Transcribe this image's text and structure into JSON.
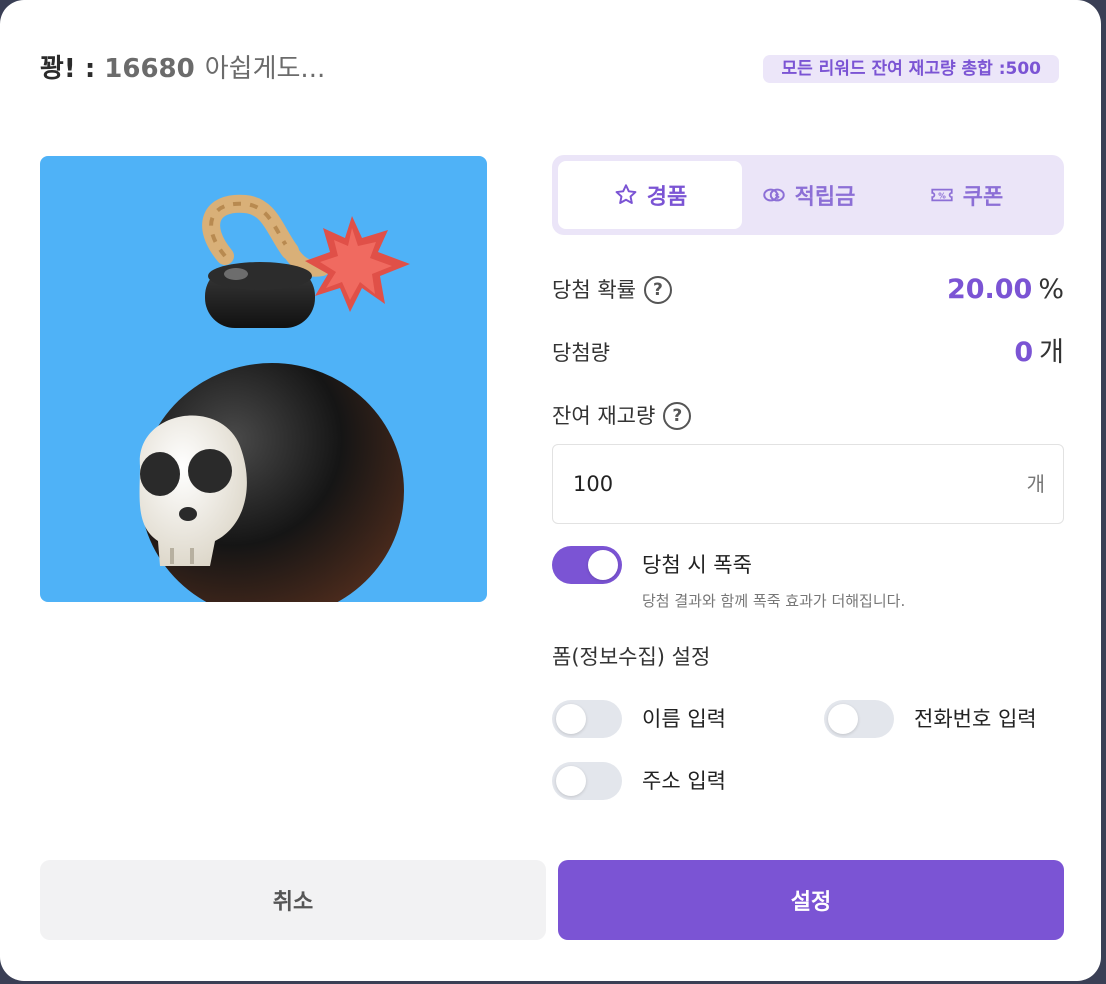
{
  "header": {
    "title_prefix": "꽝! : ",
    "score": "16680",
    "title_suffix": "아쉽게도...",
    "total_stock_badge": "모든 리워드 잔여 재고량 총합 :500"
  },
  "image": {
    "icon": "skull-bomb-image",
    "background": "#4fb2f7"
  },
  "tabs": [
    {
      "label": "경품",
      "icon": "star-icon",
      "active": true
    },
    {
      "label": "적립금",
      "icon": "coin-icon",
      "active": false
    },
    {
      "label": "쿠폰",
      "icon": "coupon-icon",
      "active": false
    }
  ],
  "win_probability": {
    "label": "당첨 확률",
    "value": "20.00",
    "unit": "%"
  },
  "win_count": {
    "label": "당첨량",
    "value": "0",
    "unit": "개"
  },
  "stock": {
    "label": "잔여 재고량",
    "value": "100",
    "unit": "개"
  },
  "fireworks": {
    "label": "당첨 시 폭죽",
    "description": "당첨 결과와 함께 폭죽 효과가 더해집니다.",
    "enabled": true
  },
  "form": {
    "title": "폼(정보수집) 설정",
    "name": {
      "label": "이름 입력",
      "enabled": false
    },
    "phone": {
      "label": "전화번호 입력",
      "enabled": false
    },
    "address": {
      "label": "주소 입력",
      "enabled": false
    }
  },
  "buttons": {
    "cancel": "취소",
    "confirm": "설정"
  },
  "colors": {
    "accent": "#7b54d4",
    "accent_light": "#ebe5f8"
  }
}
